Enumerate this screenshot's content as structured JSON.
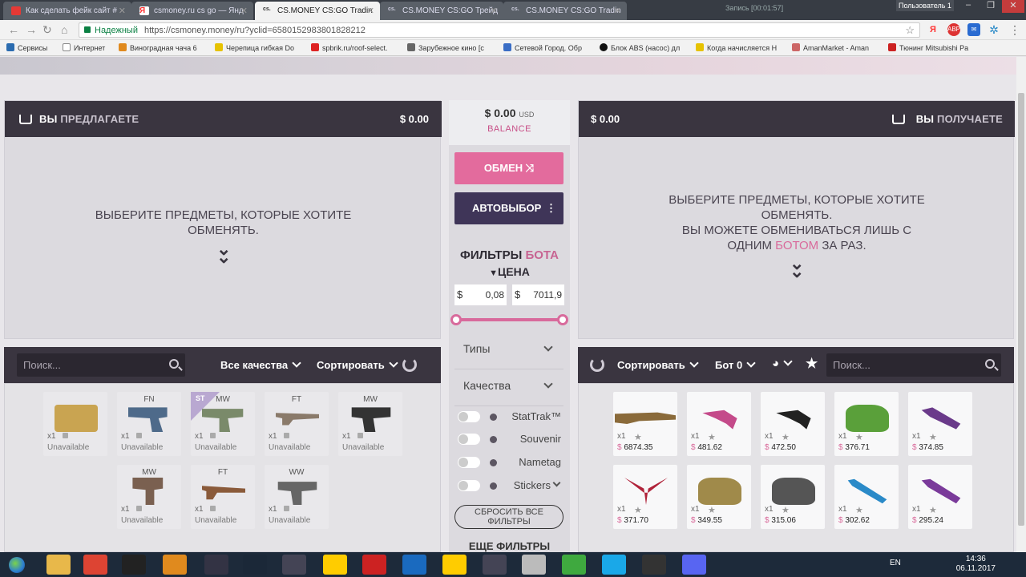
{
  "browser": {
    "tabs": [
      {
        "label": "Как сделать фейк сайт #",
        "color": "#e53935"
      },
      {
        "label": "csmoney.ru cs go — Янд",
        "color": "#ff3b30"
      },
      {
        "label": "CS.MONEY CS:GO Tradin",
        "color": "#333"
      },
      {
        "label": "CS.MONEY CS:GO Трейд",
        "color": "#333"
      },
      {
        "label": "CS.MONEY CS:GO Tradin",
        "color": "#333"
      }
    ],
    "recording": "Запись [00:01:57]",
    "user": "Пользователь 1",
    "secure_label": "Надежный",
    "url": "https://csmoney.money/ru?yclid=6580152983801828212",
    "bookmarks": [
      {
        "label": "Сервисы",
        "color": "#2b6cb0"
      },
      {
        "label": "Интернет",
        "color": "#888"
      },
      {
        "label": "Виноградная чача 6",
        "color": "#e08a1e"
      },
      {
        "label": "Черепица гибкая Do",
        "color": "#222"
      },
      {
        "label": "spbrik.ru/roof-select.",
        "color": "#d22"
      },
      {
        "label": "Зарубежное кино [с",
        "color": "#666"
      },
      {
        "label": "Сетевой Город. Обр",
        "color": "#3a6dc5"
      },
      {
        "label": "Блок ABS (насос) дл",
        "color": "#111"
      },
      {
        "label": "Когда начисляется Н",
        "color": "#e6c200"
      },
      {
        "label": "AmanMarket - Aman",
        "color": "#c66"
      },
      {
        "label": "Тюнинг Mitsubishi Pa",
        "color": "#c22"
      }
    ]
  },
  "left": {
    "title_bold": "ВЫ",
    "title_light": "ПРЕДЛАГАЕТЕ",
    "amount": "$ 0.00",
    "empty_line1": "ВЫБЕРИТЕ ПРЕДМЕТЫ, КОТОРЫЕ ХОТИТЕ",
    "empty_line2": "ОБМЕНЯТЬ.",
    "search_placeholder": "Поиск...",
    "quality_label": "Все качества",
    "sort_label": "Сортировать",
    "items": [
      {
        "quality": "",
        "count": "x1",
        "status": "Unavailable",
        "color": "#c9a451"
      },
      {
        "quality": "FN",
        "count": "x1",
        "status": "Unavailable",
        "color": "#4e6a8a"
      },
      {
        "quality": "MW",
        "count": "x1",
        "status": "Unavailable",
        "color": "#7a8a6a",
        "badge": "ST"
      },
      {
        "quality": "FT",
        "count": "x1",
        "status": "Unavailable",
        "color": "#8a7a6a"
      },
      {
        "quality": "MW",
        "count": "x1",
        "status": "Unavailable",
        "color": "#333"
      },
      {
        "quality": "MW",
        "count": "x1",
        "status": "Unavailable",
        "color": "#7a6050"
      },
      {
        "quality": "FT",
        "count": "x1",
        "status": "Unavailable",
        "color": "#8a5a3a"
      },
      {
        "quality": "WW",
        "count": "x1",
        "status": "Unavailable",
        "color": "#666"
      }
    ]
  },
  "middle": {
    "balance_value": "$ 0.00",
    "balance_currency": "USD",
    "balance_label": "BALANCE",
    "exchange_label": "ОБМЕН",
    "autoselect_label": "АВТОВЫБОР",
    "filters_bold": "ФИЛЬТРЫ",
    "filters_pink": "БОТА",
    "price_label": "ЦЕНА",
    "price_min": "0,08",
    "price_max": "7011,9",
    "currency_symbol": "$",
    "types_label": "Типы",
    "qualities_label": "Качества",
    "toggles": [
      "StatTrak™",
      "Souvenir",
      "Nametag",
      "Stickers"
    ],
    "reset_label": "СБРОСИТЬ ВСЕ ФИЛЬТРЫ",
    "more_label": "ЕЩЕ ФИЛЬТРЫ",
    "exchange_color": "#e36b9d",
    "autoselect_color": "#3f3558"
  },
  "right": {
    "title_bold": "ВЫ",
    "title_light": "ПОЛУЧАЕТЕ",
    "amount": "$ 0.00",
    "empty_line1": "ВЫБЕРИТЕ ПРЕДМЕТЫ, КОТОРЫЕ ХОТИТЕ",
    "empty_line2": "ОБМЕНЯТЬ.",
    "empty_line3_pre": "ВЫ МОЖЕТЕ ОБМЕНИВАТЬСЯ ЛИШЬ С",
    "empty_line4_pre": "ОДНИМ",
    "empty_line4_pink": "БОТОМ",
    "empty_line4_post": "ЗА РАЗ.",
    "sort_label": "Сортировать",
    "bot_label": "Бот 0",
    "search_placeholder": "Поиск...",
    "items": [
      {
        "count": "x1",
        "price": "6874.35",
        "color": "#8a6a3a"
      },
      {
        "count": "x1",
        "price": "481.62",
        "color": "#c44a8a"
      },
      {
        "count": "x1",
        "price": "472.50",
        "color": "#222"
      },
      {
        "count": "x1",
        "price": "376.71",
        "color": "#5aa03a"
      },
      {
        "count": "x1",
        "price": "374.85",
        "color": "#6a3a8a"
      },
      {
        "count": "x1",
        "price": "371.70",
        "color": "#b0233a"
      },
      {
        "count": "x1",
        "price": "349.55",
        "color": "#a08a4a"
      },
      {
        "count": "x1",
        "price": "315.06",
        "color": "#555"
      },
      {
        "count": "x1",
        "price": "302.62",
        "color": "#2a8ac8"
      },
      {
        "count": "x1",
        "price": "295.24",
        "color": "#7a3a9a"
      }
    ]
  },
  "taskbar": {
    "lang": "EN",
    "time": "14:36",
    "date": "06.11.2017",
    "apps": [
      "#e8b84a",
      "#dd4433",
      "#222",
      "#e08a1e",
      "#334",
      "#1b2838",
      "#445",
      "#ffcc00",
      "#c22",
      "#1a6abf",
      "#ffcc00",
      "#445",
      "#bbb",
      "#3fa93f",
      "#1aa8e8",
      "#333",
      "#5865f2",
      "#c00"
    ]
  }
}
